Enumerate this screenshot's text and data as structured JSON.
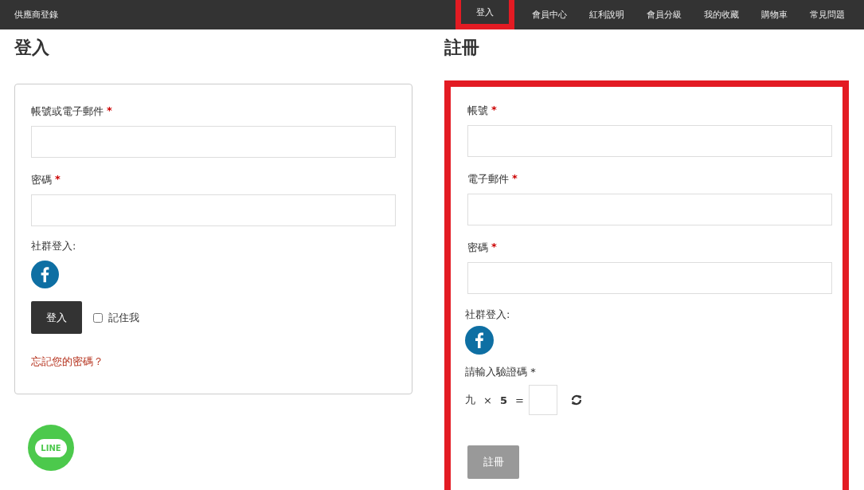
{
  "topbar": {
    "brand": "供應商登錄",
    "nav": [
      {
        "label": "登入",
        "selected": true
      },
      {
        "label": "會員中心",
        "selected": false
      },
      {
        "label": "紅利說明",
        "selected": false
      },
      {
        "label": "會員分級",
        "selected": false
      },
      {
        "label": "我的收藏",
        "selected": false
      },
      {
        "label": "購物車",
        "selected": false
      },
      {
        "label": "常見問題",
        "selected": false
      }
    ]
  },
  "login": {
    "title": "登入",
    "fields": [
      {
        "label": "帳號或電子郵件",
        "required": "*"
      },
      {
        "label": "密碼",
        "required": "*"
      }
    ],
    "social_label": "社群登入:",
    "button": "登入",
    "remember": {
      "label": "記住我",
      "checked": false
    },
    "forgot_link": "忘記您的密碼？"
  },
  "line_badge": {
    "label": "LINE"
  },
  "register": {
    "title": "註冊",
    "highlighted": true,
    "fields": [
      {
        "label": "帳號",
        "required": "*"
      },
      {
        "label": "電子郵件",
        "required": "*"
      },
      {
        "label": "密碼",
        "required": "*"
      }
    ],
    "social_label": "社群登入:",
    "captcha": {
      "label": "請輸入驗證碼 *",
      "operand_1": "九",
      "operator": "×",
      "operand_2": "5",
      "equals": "="
    },
    "button": {
      "label": "註冊",
      "disabled": true
    }
  }
}
